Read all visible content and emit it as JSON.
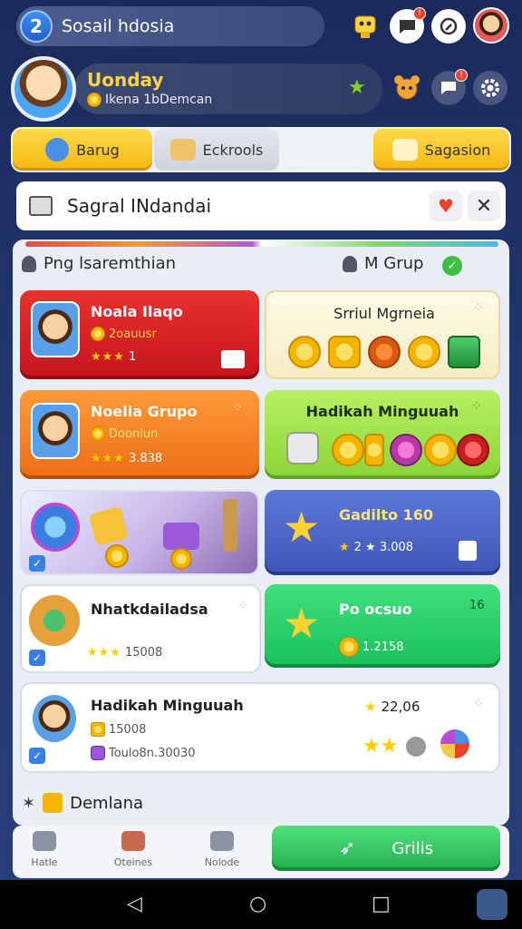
{
  "topbar": {
    "badge": "2",
    "search_text": "Sosail hdosia"
  },
  "profile": {
    "name": "Uonday",
    "subtitle": "Ikena 1bDemcan"
  },
  "tabs": [
    {
      "label": "Barug"
    },
    {
      "label": "Eckrools"
    },
    {
      "label": "Sagasion"
    }
  ],
  "notice": {
    "title": "Sagral INdandai"
  },
  "section": {
    "left_label": "Png lsaremthian",
    "right_label": "M Grup"
  },
  "cards": {
    "c1": {
      "title": "Noala Ilaqo",
      "sub": "2oauusr",
      "rating": "1"
    },
    "c2": {
      "title": "Srriul Mgrneia"
    },
    "c3": {
      "title": "Noelia Grupo",
      "sub": "Dooniun",
      "rating": "3.838"
    },
    "c4": {
      "title": "Hadikah Minguuah"
    },
    "c6": {
      "title": "Gadilto 160",
      "rating": "2 ★ 3.008"
    },
    "c7": {
      "title": "Nhatkdailadsa",
      "rating": "15008"
    },
    "c8": {
      "title": "Po ocsuo",
      "count": "16",
      "value": "1.2158"
    },
    "c9": {
      "title": "Hadikah Minguuah",
      "line1": "15008",
      "line2": "Toulo8n.30030",
      "rating": "22,06"
    }
  },
  "footer": {
    "label": "Demlana"
  },
  "bottom_nav": {
    "items": [
      {
        "label": "Hatle"
      },
      {
        "label": "Oteines"
      },
      {
        "label": "Nolode"
      }
    ],
    "go_label": "Grilis"
  },
  "colors": {
    "accent_yellow": "#f6b810",
    "accent_green": "#22b04e",
    "card_red": "#d8232a",
    "card_orange": "#f07a1e",
    "card_lime": "#9be04a",
    "card_blue": "#4a63c8"
  }
}
